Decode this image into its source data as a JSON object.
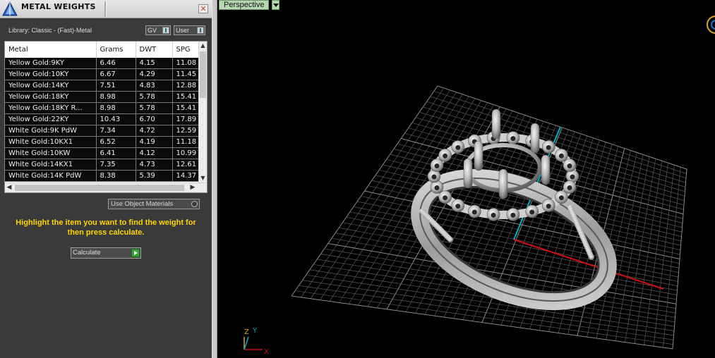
{
  "panel": {
    "title": "METAL WEIGHTS",
    "library_label": "Library: Classic - (Fast)-Metal",
    "gv_dropdown": "GV",
    "user_dropdown": "User",
    "table": {
      "headers": [
        "Metal",
        "Grams",
        "DWT",
        "SPG"
      ],
      "rows": [
        [
          "Yellow Gold:9KY",
          "6.46",
          "4.15",
          "11.08"
        ],
        [
          "Yellow Gold:10KY",
          "6.67",
          "4.29",
          "11.45"
        ],
        [
          "Yellow Gold:14KY",
          "7.51",
          "4.83",
          "12.88"
        ],
        [
          "Yellow Gold:18KY",
          "8.98",
          "5.78",
          "15.41"
        ],
        [
          "Yellow Gold:18KY R...",
          "8.98",
          "5.78",
          "15.41"
        ],
        [
          "Yellow Gold:22KY",
          "10.43",
          "6.70",
          "17.89"
        ],
        [
          "White Gold:9K PdW",
          "7.34",
          "4.72",
          "12.59"
        ],
        [
          "White Gold:10KX1",
          "6.52",
          "4.19",
          "11.18"
        ],
        [
          "White Gold:10KW",
          "6.41",
          "4.12",
          "10.99"
        ],
        [
          "White Gold:14KX1",
          "7.35",
          "4.73",
          "12.61"
        ],
        [
          "White Gold:14K PdW",
          "8.38",
          "5.39",
          "14.37"
        ]
      ]
    },
    "use_object_materials": "Use Object Materials",
    "instruction": "Highlight the item you want to find the weight for then press calculate.",
    "calculate_button": "Calculate"
  },
  "viewport": {
    "view_name": "Perspective",
    "axis_labels": {
      "z": "Z",
      "y": "Y",
      "x": "X"
    }
  },
  "colors": {
    "instruction_text": "#ffd400",
    "view_tab": "#b6d7b2",
    "x_axis": "#d01010",
    "y_axis": "#00b0d0",
    "grid": "#5a5a5a"
  }
}
